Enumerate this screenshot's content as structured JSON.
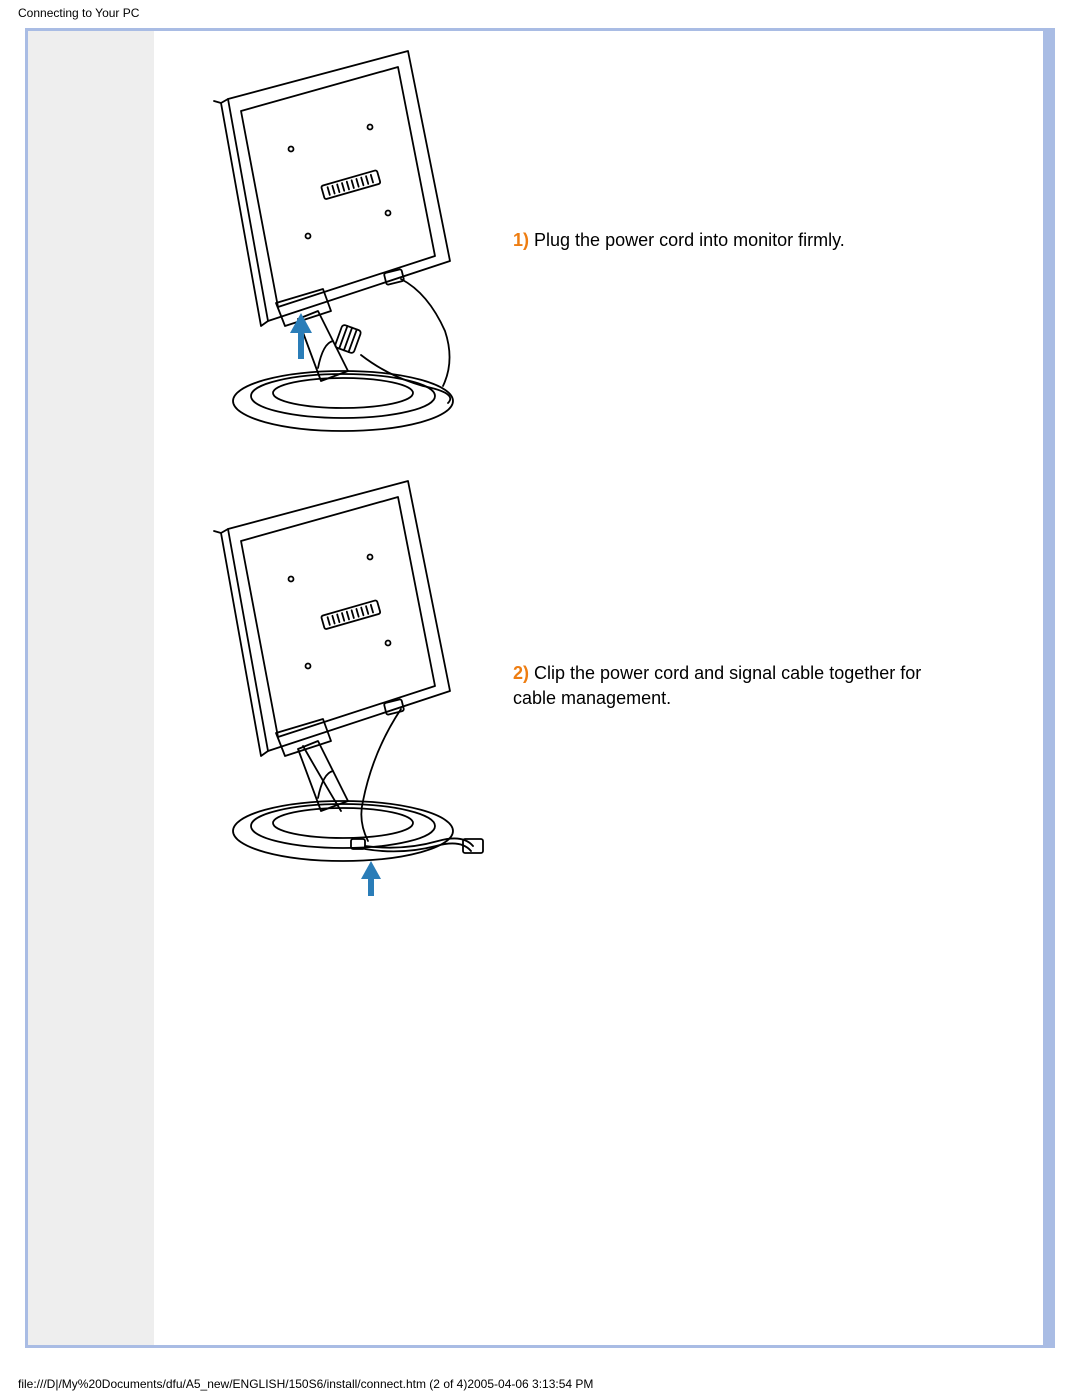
{
  "header": {
    "title": "Connecting to Your PC"
  },
  "steps": [
    {
      "num": "1)",
      "text": " Plug the power cord into monitor firmly."
    },
    {
      "num": "2)",
      "text": " Clip the power cord and signal cable together for cable management."
    }
  ],
  "footer": {
    "text": "file:///D|/My%20Documents/dfu/A5_new/ENGLISH/150S6/install/connect.htm (2 of 4)2005-04-06 3:13:54 PM"
  }
}
